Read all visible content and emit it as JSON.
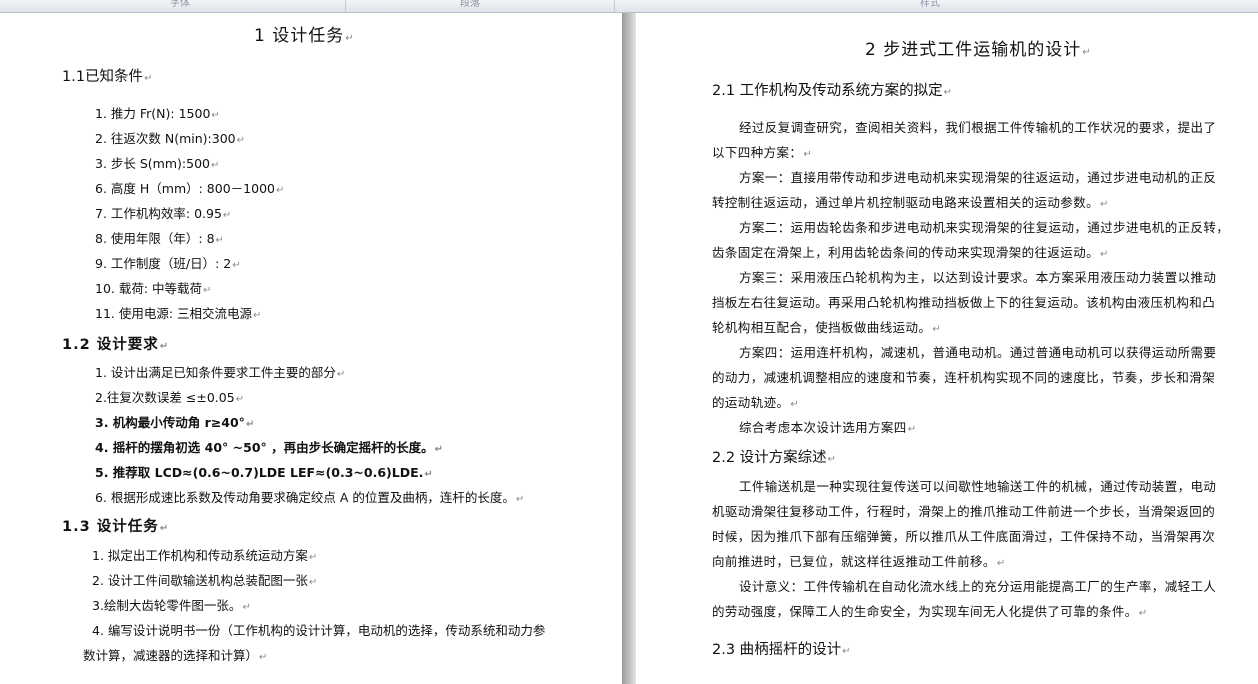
{
  "ribbon": {
    "groups": [
      "字体",
      "段落",
      "样式"
    ]
  },
  "left": {
    "title": "1 设计任务",
    "s1_title": "1.1已知条件",
    "s1_items": [
      "1. 推力 Fr(N): 1500",
      "2. 往返次数 N(min):300",
      "3. 步长 S(mm):500",
      "6. 高度 H（mm）: 800－1000",
      "7. 工作机构效率: 0.95",
      "8. 使用年限（年）: 8",
      "9. 工作制度（班/日）: 2",
      "10. 载荷: 中等载荷",
      "11. 使用电源: 三相交流电源"
    ],
    "s2_title": "1.2  设计要求",
    "s2_items": [
      "1. 设计出满足已知条件要求工件主要的部分",
      "2.往复次数误差 ≤±0.05",
      "3. 机构最小传动角 r≥40°",
      "4. 摇杆的摆角初选 40° ~50° ，再由步长确定摇杆的长度。",
      "5. 推荐取 LCD≈(0.6~0.7)LDE    LEF≈(0.3~0.6)LDE.",
      "6. 根据形成速比系数及传动角要求确定绞点 A 的位置及曲柄，连杆的长度。"
    ],
    "s3_title": "1.3  设计任务",
    "s3_items": [
      "1. 拟定出工作机构和传动系统运动方案",
      "2. 设计工件间歇输送机构总装配图一张",
      "3.绘制大齿轮零件图一张。",
      "4. 编写设计说明书一份（工作机构的设计计算，电动机的选择，传动系统和动力参",
      "数计算，减速器的选择和计算）"
    ]
  },
  "right": {
    "title": "2 步进式工件运输机的设计",
    "s1_title": "2.1 工作机构及传动系统方案的拟定",
    "s1_lines": [
      "经过反复调查研究，查阅相关资料，我们根据工件传输机的工作状况的要求，提出了",
      "以下四种方案：",
      "方案一：直接用带传动和步进电动机来实现滑架的往返运动，通过步进电动机的正反",
      "转控制往返运动，通过单片机控制驱动电路来设置相关的运动参数。",
      "方案二：运用齿轮齿条和步进电动机来实现滑架的往复运动，通过步进电机的正反转，",
      "齿条固定在滑架上，利用齿轮齿条间的传动来实现滑架的往返运动。",
      "方案三：采用液压凸轮机构为主，以达到设计要求。本方案采用液压动力装置以推动",
      "挡板左右往复运动。再采用凸轮机构推动挡板做上下的往复运动。该机构由液压机构和凸",
      "轮机构相互配合，使挡板做曲线运动。",
      "方案四：运用连杆机构，减速机，普通电动机。通过普通电动机可以获得运动所需要",
      "的动力，减速机调整相应的速度和节奏，连杆机构实现不同的速度比，节奏，步长和滑架",
      "的运动轨迹。",
      "综合考虑本次设计选用方案四"
    ],
    "s2_title": "2.2 设计方案综述",
    "s2_lines": [
      "工件输送机是一种实现往复传送可以间歇性地输送工件的机械，通过传动装置，电动",
      "机驱动滑架往复移动工件，行程时，滑架上的推爪推动工件前进一个步长，当滑架返回的",
      "时候，因为推爪下部有压缩弹簧，所以推爪从工件底面滑过，工件保持不动，当滑架再次",
      "向前推进时，已复位，就这样往返推动工件前移。",
      "设计意义：工件传输机在自动化流水线上的充分运用能提高工厂的生产率，减轻工人",
      "的劳动强度，保障工人的生命安全，为实现车间无人化提供了可靠的条件。"
    ],
    "s3_title": "2.3 曲柄摇杆的设计"
  }
}
